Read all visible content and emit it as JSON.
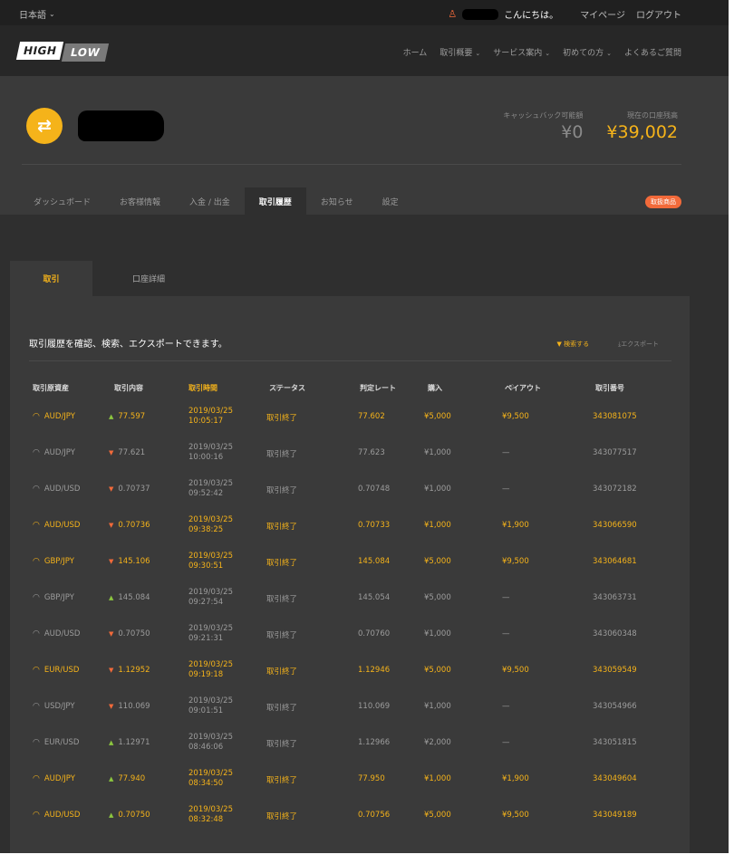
{
  "topbar": {
    "language": "日本語",
    "greeting": "こんにちは。",
    "mypage": "マイページ",
    "logout": "ログアウト"
  },
  "header": {
    "logo_high": "HIGH",
    "logo_low": "LOW",
    "nav": [
      {
        "label": "ホーム",
        "has_caret": false
      },
      {
        "label": "取引概要",
        "has_caret": true
      },
      {
        "label": "サービス案内",
        "has_caret": true
      },
      {
        "label": "初めての方",
        "has_caret": true
      },
      {
        "label": "よくあるご質問",
        "has_caret": false
      }
    ]
  },
  "account": {
    "cashback_label": "キャッシュバック可能額",
    "cashback_value": "¥0",
    "current_label": "現在の口座残高",
    "current_value": "¥39,002",
    "tabs": [
      {
        "label": "ダッシュボード",
        "active": false
      },
      {
        "label": "お客様情報",
        "active": false
      },
      {
        "label": "入金 / 出金",
        "active": false
      },
      {
        "label": "取引履歴",
        "active": true
      },
      {
        "label": "お知らせ",
        "active": false
      },
      {
        "label": "設定",
        "active": false
      }
    ],
    "promo_badge": "取扱商品"
  },
  "content_tabs": [
    {
      "label": "取引",
      "active": true
    },
    {
      "label": "口座詳細",
      "active": false
    }
  ],
  "panel": {
    "description": "取引履歴を確認、検索、エクスポートできます。",
    "search_label": "検索する",
    "export_label": "エクスポート"
  },
  "table": {
    "headers": [
      "取引原資産",
      "取引内容",
      "取引時間",
      "ステータス",
      "判定レート",
      "購入",
      "ペイアウト",
      "取引番号"
    ],
    "rows": [
      {
        "asset": "AUD/JPY",
        "direction": "up",
        "rate": "77.597",
        "date": "2019/03/25",
        "time": "10:05:17",
        "status": "取引終了",
        "close_rate": "77.602",
        "purchase": "¥5,000",
        "payout": "¥9,500",
        "trade_id": "343081075",
        "win": true
      },
      {
        "asset": "AUD/JPY",
        "direction": "down",
        "rate": "77.621",
        "date": "2019/03/25",
        "time": "10:00:16",
        "status": "取引終了",
        "close_rate": "77.623",
        "purchase": "¥1,000",
        "payout": "—",
        "trade_id": "343077517",
        "win": false
      },
      {
        "asset": "AUD/USD",
        "direction": "down",
        "rate": "0.70737",
        "date": "2019/03/25",
        "time": "09:52:42",
        "status": "取引終了",
        "close_rate": "0.70748",
        "purchase": "¥1,000",
        "payout": "—",
        "trade_id": "343072182",
        "win": false
      },
      {
        "asset": "AUD/USD",
        "direction": "down",
        "rate": "0.70736",
        "date": "2019/03/25",
        "time": "09:38:25",
        "status": "取引終了",
        "close_rate": "0.70733",
        "purchase": "¥1,000",
        "payout": "¥1,900",
        "trade_id": "343066590",
        "win": true
      },
      {
        "asset": "GBP/JPY",
        "direction": "down",
        "rate": "145.106",
        "date": "2019/03/25",
        "time": "09:30:51",
        "status": "取引終了",
        "close_rate": "145.084",
        "purchase": "¥5,000",
        "payout": "¥9,500",
        "trade_id": "343064681",
        "win": true
      },
      {
        "asset": "GBP/JPY",
        "direction": "up",
        "rate": "145.084",
        "date": "2019/03/25",
        "time": "09:27:54",
        "status": "取引終了",
        "close_rate": "145.054",
        "purchase": "¥5,000",
        "payout": "—",
        "trade_id": "343063731",
        "win": false
      },
      {
        "asset": "AUD/USD",
        "direction": "down",
        "rate": "0.70750",
        "date": "2019/03/25",
        "time": "09:21:31",
        "status": "取引終了",
        "close_rate": "0.70760",
        "purchase": "¥1,000",
        "payout": "—",
        "trade_id": "343060348",
        "win": false
      },
      {
        "asset": "EUR/USD",
        "direction": "down",
        "rate": "1.12952",
        "date": "2019/03/25",
        "time": "09:19:18",
        "status": "取引終了",
        "close_rate": "1.12946",
        "purchase": "¥5,000",
        "payout": "¥9,500",
        "trade_id": "343059549",
        "win": true
      },
      {
        "asset": "USD/JPY",
        "direction": "down",
        "rate": "110.069",
        "date": "2019/03/25",
        "time": "09:01:51",
        "status": "取引終了",
        "close_rate": "110.069",
        "purchase": "¥1,000",
        "payout": "—",
        "trade_id": "343054966",
        "win": false
      },
      {
        "asset": "EUR/USD",
        "direction": "up",
        "rate": "1.12971",
        "date": "2019/03/25",
        "time": "08:46:06",
        "status": "取引終了",
        "close_rate": "1.12966",
        "purchase": "¥2,000",
        "payout": "—",
        "trade_id": "343051815",
        "win": false
      },
      {
        "asset": "AUD/JPY",
        "direction": "up",
        "rate": "77.940",
        "date": "2019/03/25",
        "time": "08:34:50",
        "status": "取引終了",
        "close_rate": "77.950",
        "purchase": "¥1,000",
        "payout": "¥1,900",
        "trade_id": "343049604",
        "win": true
      },
      {
        "asset": "AUD/USD",
        "direction": "up",
        "rate": "0.70750",
        "date": "2019/03/25",
        "time": "08:32:48",
        "status": "取引終了",
        "close_rate": "0.70756",
        "purchase": "¥5,000",
        "payout": "¥9,500",
        "trade_id": "343049189",
        "win": true
      }
    ]
  },
  "colors": {
    "accent": "#f5b31a",
    "up": "#8cc63f",
    "down": "#f26a3a",
    "badge": "#f26a3a"
  }
}
